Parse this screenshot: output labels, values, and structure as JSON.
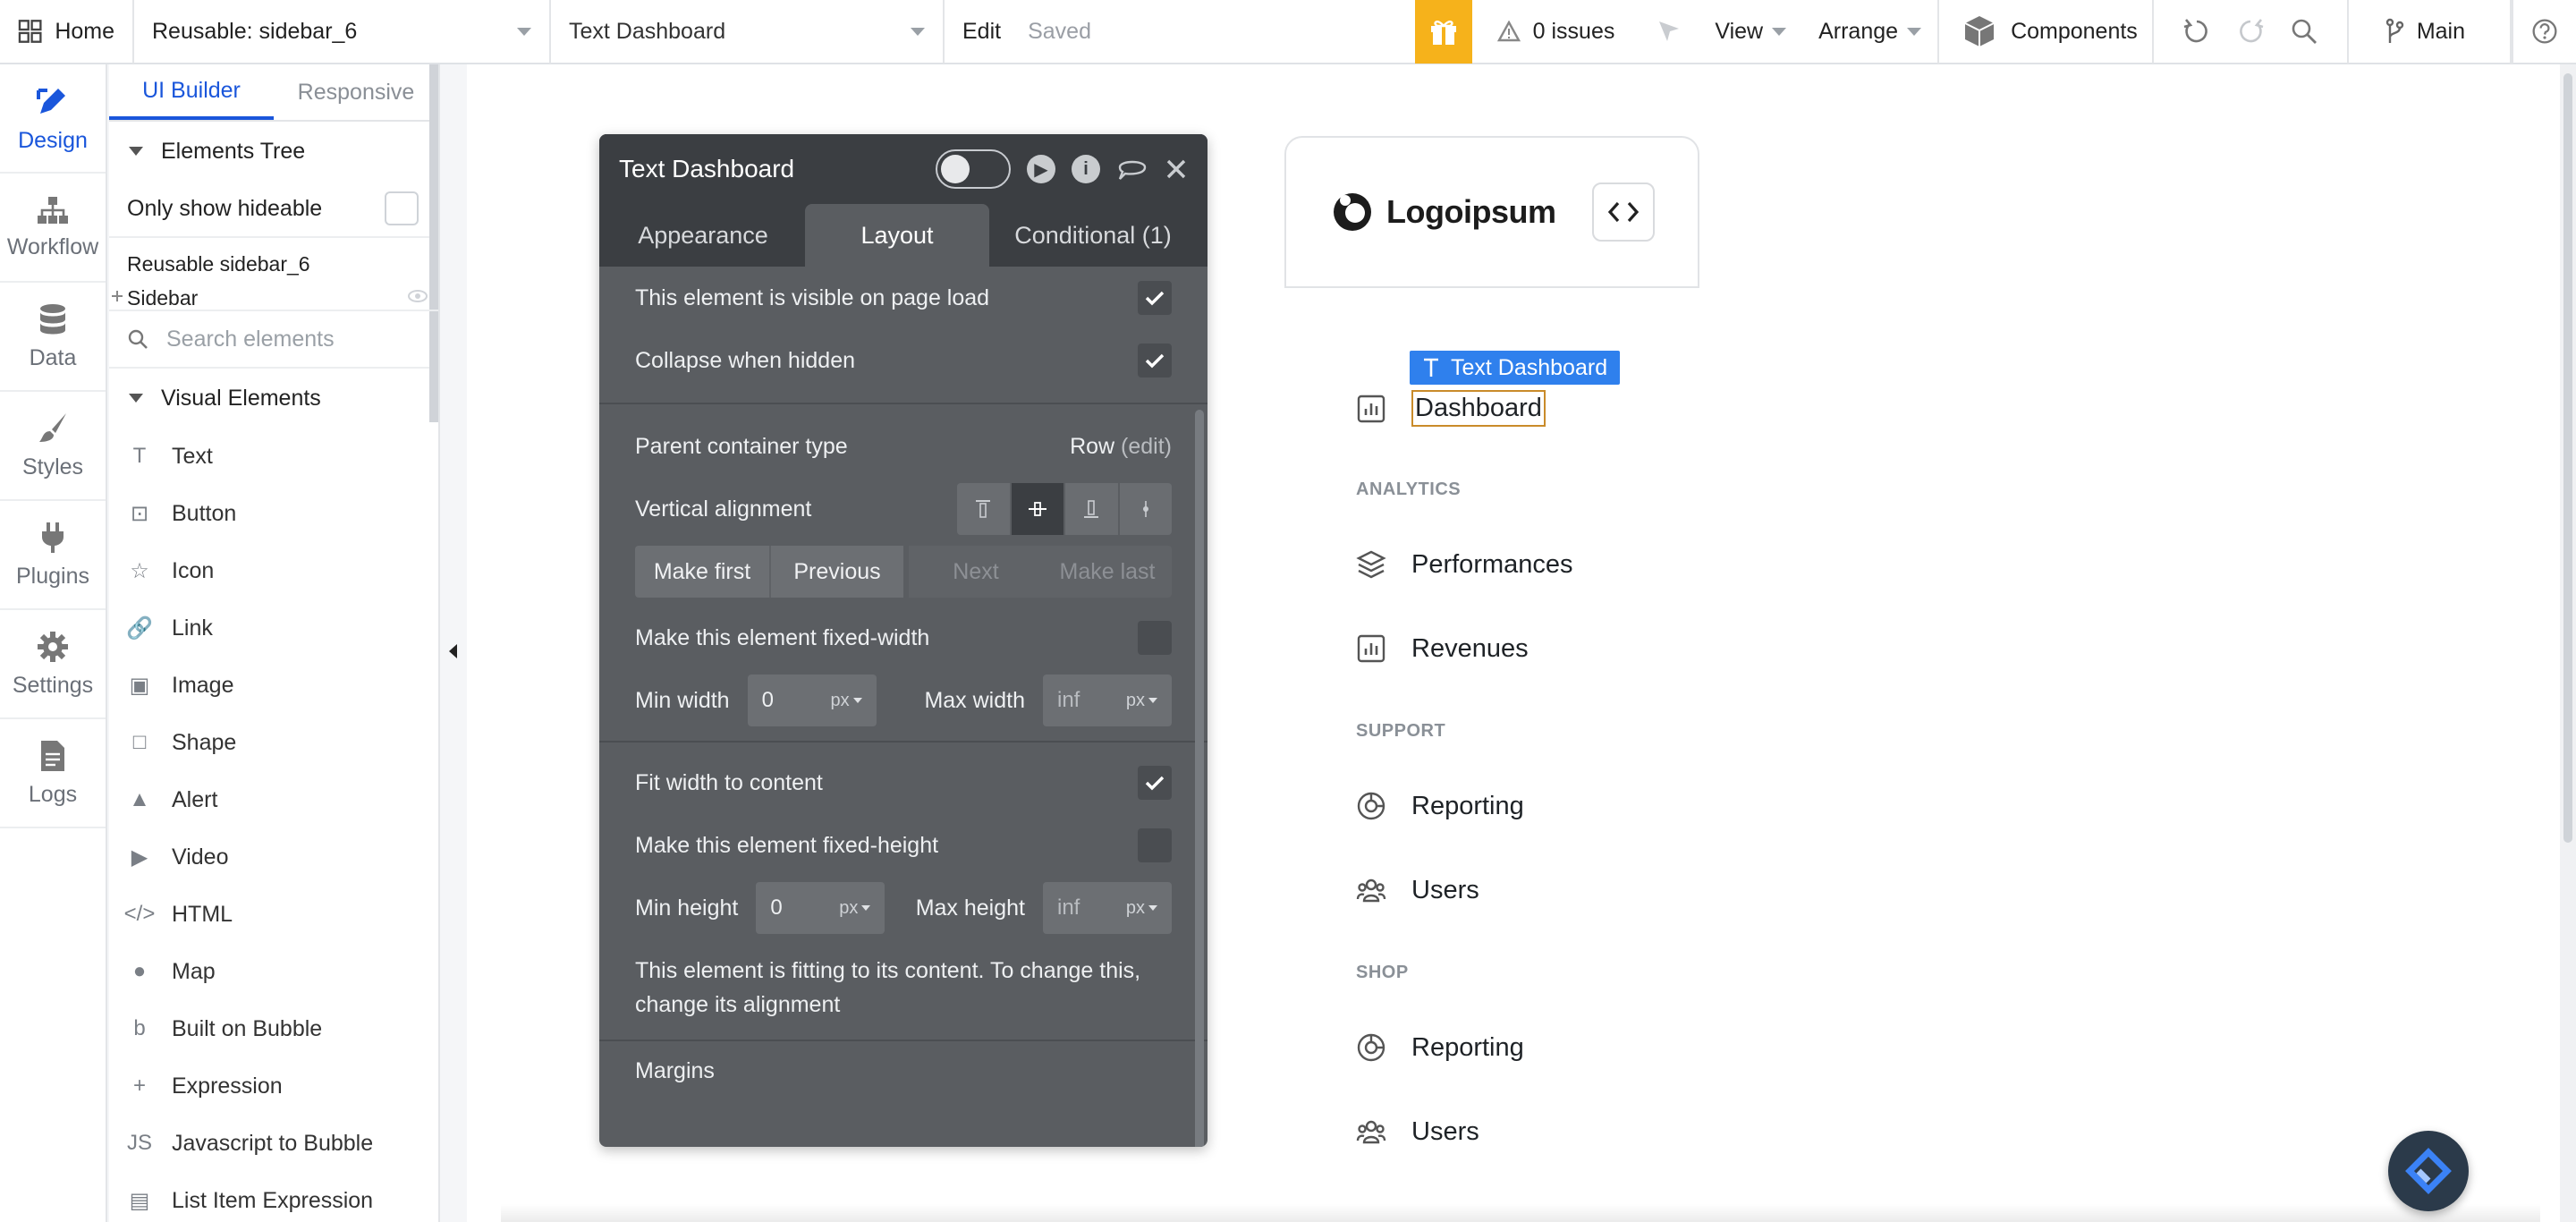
{
  "topbar": {
    "home_label": "Home",
    "reusable_label": "Reusable: sidebar_6",
    "page_label": "Text Dashboard",
    "edit_label": "Edit",
    "saved_label": "Saved",
    "issues_label": "0 issues",
    "view_label": "View",
    "arrange_label": "Arrange",
    "components_label": "Components",
    "branch_label": "Main",
    "gift_color": "#f6b21b"
  },
  "rail": {
    "items": [
      {
        "label": "Design",
        "icon": "design-pen-icon"
      },
      {
        "label": "Workflow",
        "icon": "workflow-icon"
      },
      {
        "label": "Data",
        "icon": "database-icon"
      },
      {
        "label": "Styles",
        "icon": "brush-icon"
      },
      {
        "label": "Plugins",
        "icon": "plug-icon"
      },
      {
        "label": "Settings",
        "icon": "gear-icon"
      },
      {
        "label": "Logs",
        "icon": "logs-icon"
      }
    ],
    "accent": "#1a56db"
  },
  "palette": {
    "tabs": [
      "UI Builder",
      "Responsive"
    ],
    "elements_tree_label": "Elements Tree",
    "only_hideable_label": "Only show hideable",
    "tree_line1": "Reusable sidebar_6",
    "tree_line2": "Sidebar",
    "search_placeholder": "Search elements",
    "visual_elements_label": "Visual Elements",
    "elements": [
      {
        "label": "Text",
        "icon": "T"
      },
      {
        "label": "Button",
        "icon": "⊡"
      },
      {
        "label": "Icon",
        "icon": "☆"
      },
      {
        "label": "Link",
        "icon": "🔗"
      },
      {
        "label": "Image",
        "icon": "▣"
      },
      {
        "label": "Shape",
        "icon": "□"
      },
      {
        "label": "Alert",
        "icon": "▲"
      },
      {
        "label": "Video",
        "icon": "▶"
      },
      {
        "label": "HTML",
        "icon": "</>"
      },
      {
        "label": "Map",
        "icon": "●"
      },
      {
        "label": "Built on Bubble",
        "icon": "b"
      },
      {
        "label": "Expression",
        "icon": "+"
      },
      {
        "label": "Javascript to Bubble",
        "icon": "JS"
      },
      {
        "label": "List Item Expression",
        "icon": "▤"
      }
    ]
  },
  "editor": {
    "title": "Text Dashboard",
    "tabs": [
      "Appearance",
      "Layout",
      "Conditional (1)"
    ],
    "visible_on_load": "This element is visible on page load",
    "collapse_hidden": "Collapse when hidden",
    "parent_type_label": "Parent container type",
    "parent_type_value": "Row",
    "parent_type_edit": "(edit)",
    "vertical_alignment_label": "Vertical alignment",
    "order_buttons": [
      "Make first",
      "Previous",
      "Next",
      "Make last"
    ],
    "fixed_width_label": "Make this element fixed-width",
    "min_width_label": "Min width",
    "min_width_value": "0",
    "max_width_label": "Max width",
    "max_width_value": "inf",
    "unit": "px",
    "fit_width_label": "Fit width to content",
    "fixed_height_label": "Make this element fixed-height",
    "min_height_label": "Min height",
    "min_height_value": "0",
    "max_height_label": "Max height",
    "max_height_value": "inf",
    "note": "This element is fitting to its content. To change this, change its alignment",
    "margins_label": "Margins"
  },
  "preview": {
    "logo_text": "Logoipsum",
    "selected_badge": "Text Dashboard",
    "dashboard": "Dashboard",
    "sections": [
      {
        "title": "ANALYTICS",
        "items": [
          "Performances",
          "Revenues"
        ]
      },
      {
        "title": "SUPPORT",
        "items": [
          "Reporting",
          "Users"
        ]
      },
      {
        "title": "SHOP",
        "items": [
          "Reporting",
          "Users"
        ]
      }
    ],
    "badge_color": "#2f80ed"
  }
}
